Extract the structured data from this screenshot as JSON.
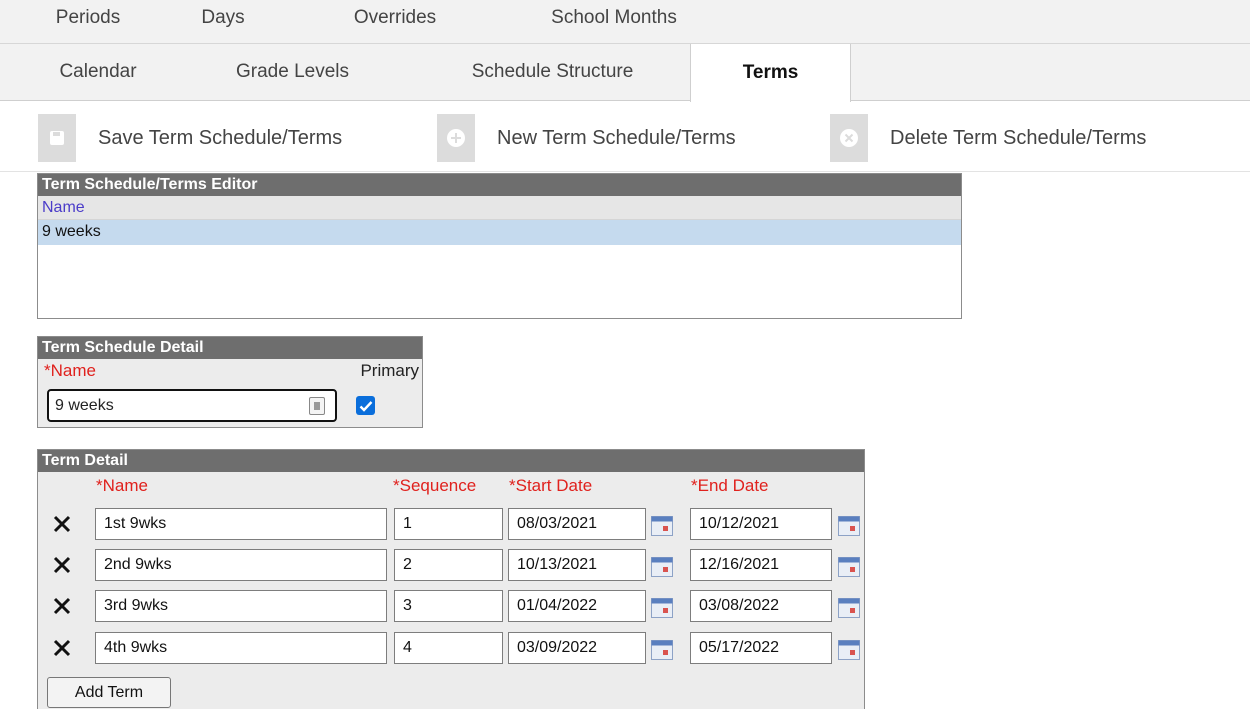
{
  "tabs_row1": [
    "Periods",
    "Days",
    "Overrides",
    "School Months"
  ],
  "tabs_row2": [
    "Calendar",
    "Grade Levels",
    "Schedule Structure",
    "Terms"
  ],
  "toolbar": {
    "save_label": "Save Term Schedule/Terms",
    "new_label": "New Term Schedule/Terms",
    "delete_label": "Delete Term Schedule/Terms"
  },
  "editor": {
    "title": "Term Schedule/Terms Editor",
    "column": "Name",
    "rows": [
      "9 weeks"
    ]
  },
  "schedule_detail": {
    "title": "Term Schedule Detail",
    "name_label": "*Name",
    "primary_label": "Primary",
    "name_value": "9 weeks",
    "primary_checked": true
  },
  "term_detail": {
    "title": "Term Detail",
    "headers": {
      "name": "*Name",
      "sequence": "*Sequence",
      "start": "*Start Date",
      "end": "*End Date"
    },
    "terms": [
      {
        "name": "1st 9wks",
        "sequence": "1",
        "start": "08/03/2021",
        "end": "10/12/2021"
      },
      {
        "name": "2nd 9wks",
        "sequence": "2",
        "start": "10/13/2021",
        "end": "12/16/2021"
      },
      {
        "name": "3rd 9wks",
        "sequence": "3",
        "start": "01/04/2022",
        "end": "03/08/2022"
      },
      {
        "name": "4th 9wks",
        "sequence": "4",
        "start": "03/09/2022",
        "end": "05/17/2022"
      }
    ],
    "add_label": "Add Term"
  },
  "colors": {
    "required": "#e0211d",
    "panel_header": "#6e6e6e",
    "selected_row": "#c5daee",
    "column_header_text": "#4b3cc9",
    "checkbox": "#0a6edb"
  },
  "icons": [
    "save-icon",
    "plus-circle-icon",
    "close-circle-icon",
    "delete-x-icon",
    "calendar-icon"
  ]
}
